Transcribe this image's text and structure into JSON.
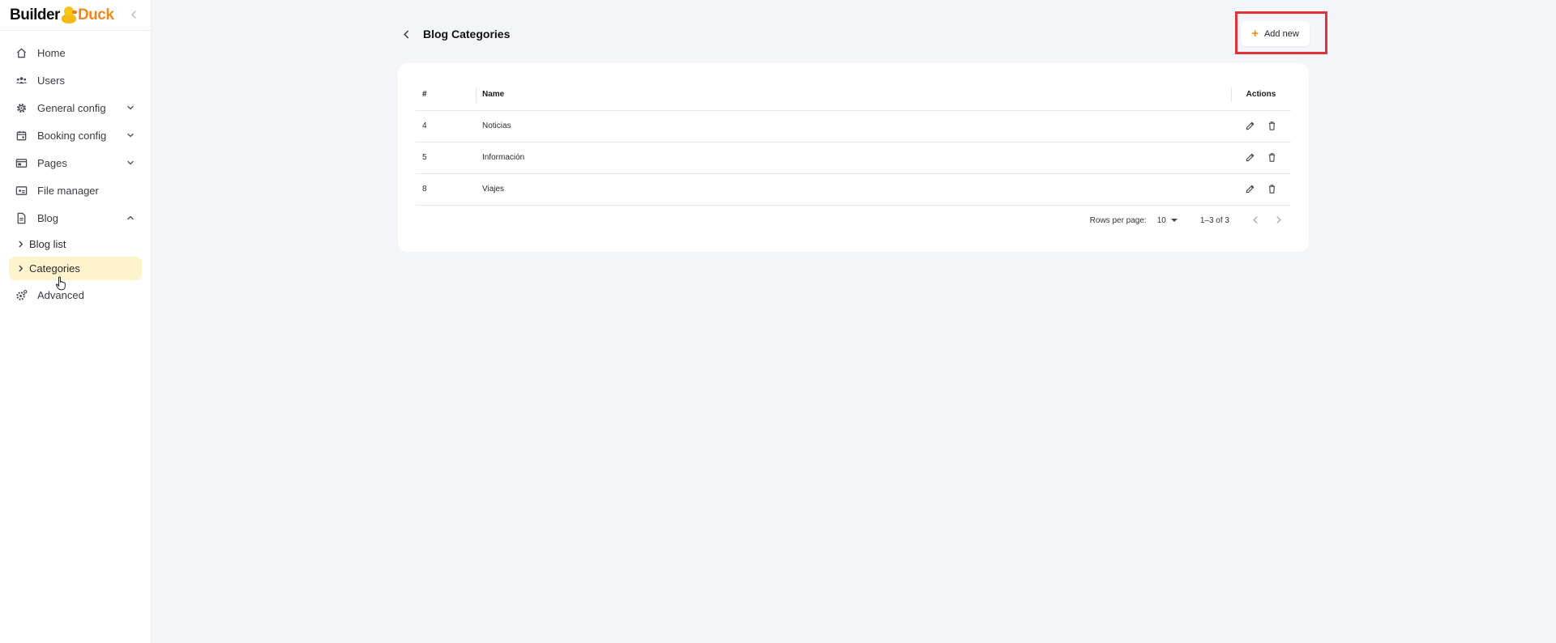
{
  "brand": {
    "part1": "Builder",
    "part2": "Duck"
  },
  "sidebar": {
    "items": [
      {
        "label": "Home",
        "icon": "home-icon"
      },
      {
        "label": "Users",
        "icon": "users-icon"
      },
      {
        "label": "General config",
        "icon": "gear-icon",
        "expandable": true
      },
      {
        "label": "Booking config",
        "icon": "calendar-icon",
        "expandable": true
      },
      {
        "label": "Pages",
        "icon": "pages-icon",
        "expandable": true
      },
      {
        "label": "File manager",
        "icon": "folder-icon"
      },
      {
        "label": "Blog",
        "icon": "document-icon",
        "expanded": true
      }
    ],
    "blog_sub": [
      {
        "label": "Blog list"
      },
      {
        "label": "Categories",
        "active": true
      }
    ],
    "advanced": {
      "label": "Advanced",
      "icon": "advanced-gear-icon"
    }
  },
  "page": {
    "title": "Blog Categories"
  },
  "toolbar": {
    "add_label": "Add new"
  },
  "table": {
    "headers": {
      "num": "#",
      "name": "Name",
      "actions": "Actions"
    },
    "rows": [
      {
        "id": "4",
        "name": "Noticias"
      },
      {
        "id": "5",
        "name": "Información"
      },
      {
        "id": "8",
        "name": "Viajes"
      }
    ]
  },
  "pagination": {
    "rows_per_page_label": "Rows per page:",
    "rows_per_page_value": "10",
    "range": "1–3 of 3"
  },
  "colors": {
    "accent": "#f0881d",
    "active_bg": "#fdf3cd",
    "highlight": "#e0323a",
    "background": "#f4f5f9"
  }
}
